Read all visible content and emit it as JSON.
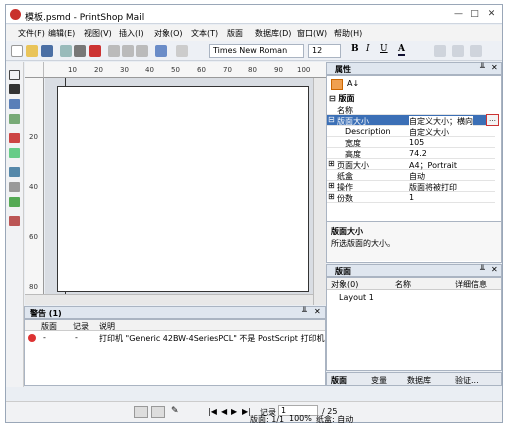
{
  "window": {
    "title": "模板.psmd - PrintShop Mail",
    "min": "—",
    "max": "□",
    "close": "✕"
  },
  "menu": [
    "文件(F)",
    "编辑(E)",
    "视图(V)",
    "插入(I)",
    "对象(O)",
    "文本(T)",
    "版面",
    "数据库(D)",
    "窗口(W)",
    "帮助(H)"
  ],
  "toolbar": {
    "font": "Times New Roman",
    "size": "12",
    "bold": "B",
    "italic": "I",
    "underline": "U",
    "color": "A"
  },
  "ruler": {
    "h": [
      "10",
      "20",
      "30",
      "40",
      "50",
      "60",
      "70",
      "80",
      "90",
      "100"
    ],
    "v": [
      "20",
      "40",
      "60",
      "80"
    ]
  },
  "properties": {
    "title": "属性",
    "section": "版面",
    "rows": [
      {
        "name": "名称",
        "value": ""
      },
      {
        "name": "版面大小",
        "value": "自定义大小；横向"
      },
      {
        "name": "Description",
        "value": "自定义大小"
      },
      {
        "name": "宽度",
        "value": "105"
      },
      {
        "name": "高度",
        "value": "74.2"
      },
      {
        "name": "页面大小",
        "value": "A4；Portrait"
      },
      {
        "name": "纸盒",
        "value": "自动"
      },
      {
        "name": "操作",
        "value": "版面将被打印"
      },
      {
        "name": "份数",
        "value": "1"
      }
    ],
    "desc_title": "版面大小",
    "desc_text": "所选版面的大小。"
  },
  "layouts": {
    "title": "版面",
    "cols": [
      "对象(0)",
      "名称",
      "详细信息"
    ],
    "item": "Layout 1",
    "tabs": [
      "版面",
      "变量",
      "数据库",
      "验证..."
    ]
  },
  "warnings": {
    "title": "警告 (1)",
    "cols": [
      "版面",
      "记录",
      "说明"
    ],
    "row": {
      "layout": "-",
      "record": "-",
      "text": "打印机 \"Generic 42BW-4SeriesPCL\" 不是 PostScript 打印机"
    }
  },
  "status": {
    "record_label": "记录",
    "record": "1",
    "total": "/ 25",
    "page": "版面: 1/1",
    "zoom": "100%",
    "tray": "纸盒: 自动"
  },
  "colors": {
    "accent": "#3b6fb6",
    "titlebar": "#ffffff",
    "error": "#d33"
  }
}
